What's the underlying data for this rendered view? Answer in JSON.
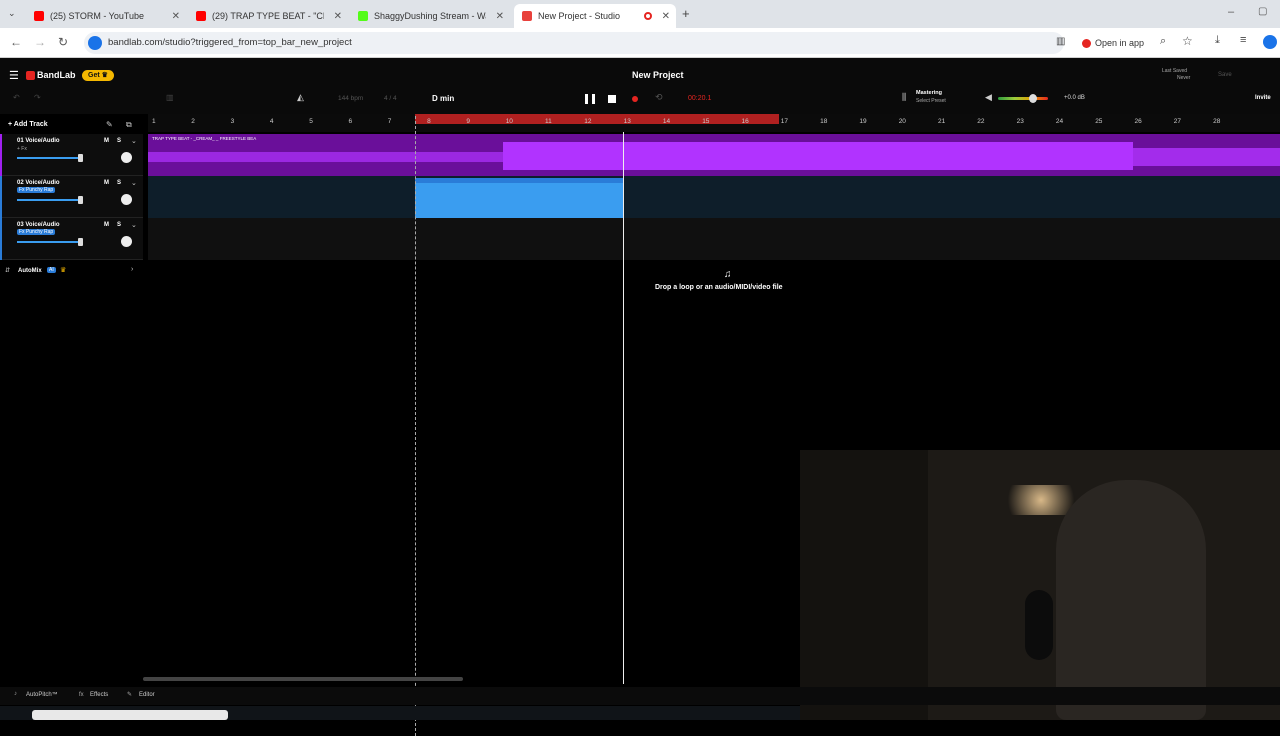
{
  "browser": {
    "tabs": [
      {
        "title": "(25) STORM - YouTube",
        "color": "#ff0000"
      },
      {
        "title": "(29) TRAP TYPE BEAT - \"CREAM",
        "color": "#ff0000"
      },
      {
        "title": "ShaggyDushing Stream - Watch",
        "color": "#53fc18"
      },
      {
        "title": "New Project - Studio",
        "color": "#e8413c"
      }
    ],
    "url": "bandlab.com/studio?triggered_from=top_bar_new_project",
    "open_in_app": "Open in app"
  },
  "app": {
    "brand": "BandLab",
    "get_label": "Get",
    "project_title": "New Project",
    "bpm": "144 bpm",
    "time_sig": "4 / 4",
    "key": "D min",
    "time": "00:20.1",
    "mastering": "Mastering",
    "select_preset": "Select Preset",
    "volume_db": "+0.0 dB",
    "last_saved_label": "Last Saved",
    "last_saved_value": "Never",
    "save_label": "Save",
    "invite_label": "Invite",
    "add_track": "Add Track",
    "automix": "AutoMix",
    "ai_badge": "AI",
    "drop_hint": "Drop a loop or an audio/MIDI/video file",
    "clip_title": "TRAP TYPE BEAT - _CREAM_ _ FREESTYLE BEA",
    "bottom": {
      "autopitch": "AutoPitch™",
      "effects": "Effects",
      "editor": "Editor"
    },
    "accent": "#e52521"
  },
  "ruler": [
    "1",
    "2",
    "3",
    "4",
    "5",
    "6",
    "7",
    "8",
    "9",
    "10",
    "11",
    "12",
    "13",
    "14",
    "15",
    "16",
    "17",
    "18",
    "19",
    "20",
    "21",
    "22",
    "23",
    "24",
    "25",
    "26",
    "27",
    "28"
  ],
  "tracks": [
    {
      "name": "01 Voice/Audio",
      "sub": "+ Fx",
      "m": "M",
      "s": "S"
    },
    {
      "name": "02 Voice/Audio",
      "sub": "Fx Punchy Rap",
      "m": "M",
      "s": "S"
    },
    {
      "name": "03 Voice/Audio",
      "sub": "Fx Punchy Rap",
      "m": "M",
      "s": "S"
    }
  ]
}
